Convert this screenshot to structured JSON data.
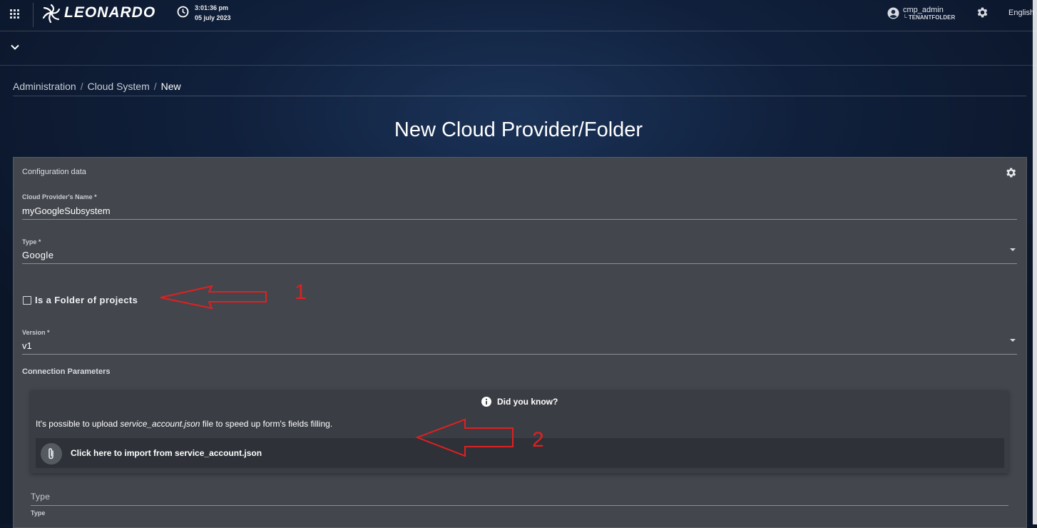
{
  "header": {
    "brand": "LEONARDO",
    "time": "3:01:36 pm",
    "date": "05 july 2023",
    "user": "cmp_admin",
    "tenant": "└ TENANTFOLDER",
    "language": "English"
  },
  "breadcrumb": [
    "Administration",
    "Cloud System",
    "New"
  ],
  "page_title": "New Cloud Provider/Folder",
  "card": {
    "title": "Configuration data",
    "name_field": {
      "label": "Cloud Provider's Name *",
      "value": "myGoogleSubsystem"
    },
    "type_field": {
      "label": "Type *",
      "value": "Google"
    },
    "folder_checkbox": {
      "label": "Is a Folder of projects",
      "checked": false
    },
    "version_field": {
      "label": "Version *",
      "value": "v1"
    },
    "connection_title": "Connection Parameters",
    "info": {
      "title": "Did you know?",
      "text_before": "It's possible to upload ",
      "text_file": "service_account.json",
      "text_after": " file to speed up form's fields filling.",
      "import_label": "Click here to import from service_account.json"
    },
    "type_section_label": "Type",
    "type_field_label": "Type"
  },
  "annotations": {
    "one": "1",
    "two": "2"
  },
  "colors": {
    "annotation": "#e02020",
    "card": "#43464d",
    "background": "#10203c"
  },
  "icons": [
    "apps-grid-icon",
    "leonardo-logo-icon",
    "clock-icon",
    "account-icon",
    "gear-icon",
    "chevron-down-icon",
    "info-icon",
    "paperclip-icon"
  ]
}
